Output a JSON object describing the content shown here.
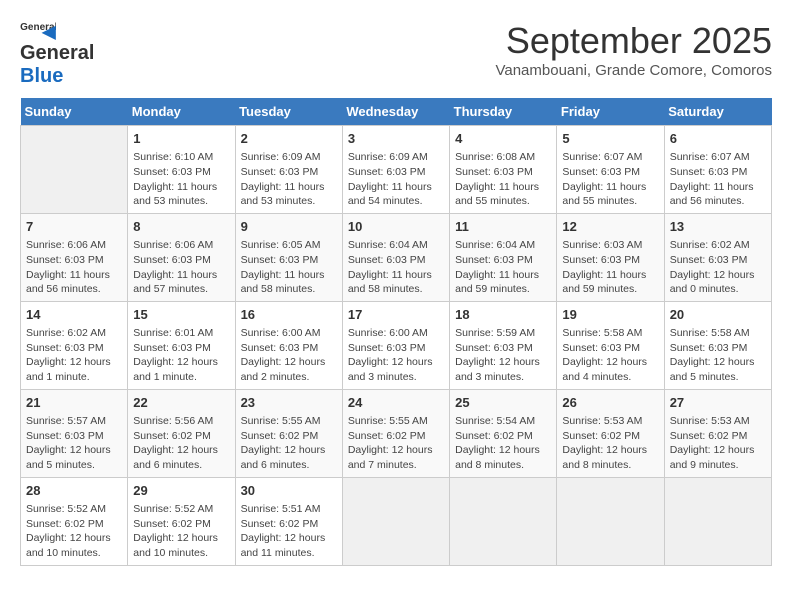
{
  "header": {
    "logo_top": "General",
    "logo_bottom": "Blue",
    "month": "September 2025",
    "location": "Vanambouani, Grande Comore, Comoros"
  },
  "days_of_week": [
    "Sunday",
    "Monday",
    "Tuesday",
    "Wednesday",
    "Thursday",
    "Friday",
    "Saturday"
  ],
  "weeks": [
    [
      {
        "day": "",
        "empty": true
      },
      {
        "day": "1",
        "sunrise": "6:10 AM",
        "sunset": "6:03 PM",
        "daylight": "11 hours and 53 minutes."
      },
      {
        "day": "2",
        "sunrise": "6:09 AM",
        "sunset": "6:03 PM",
        "daylight": "11 hours and 53 minutes."
      },
      {
        "day": "3",
        "sunrise": "6:09 AM",
        "sunset": "6:03 PM",
        "daylight": "11 hours and 54 minutes."
      },
      {
        "day": "4",
        "sunrise": "6:08 AM",
        "sunset": "6:03 PM",
        "daylight": "11 hours and 55 minutes."
      },
      {
        "day": "5",
        "sunrise": "6:07 AM",
        "sunset": "6:03 PM",
        "daylight": "11 hours and 55 minutes."
      },
      {
        "day": "6",
        "sunrise": "6:07 AM",
        "sunset": "6:03 PM",
        "daylight": "11 hours and 56 minutes."
      }
    ],
    [
      {
        "day": "7",
        "sunrise": "6:06 AM",
        "sunset": "6:03 PM",
        "daylight": "11 hours and 56 minutes."
      },
      {
        "day": "8",
        "sunrise": "6:06 AM",
        "sunset": "6:03 PM",
        "daylight": "11 hours and 57 minutes."
      },
      {
        "day": "9",
        "sunrise": "6:05 AM",
        "sunset": "6:03 PM",
        "daylight": "11 hours and 58 minutes."
      },
      {
        "day": "10",
        "sunrise": "6:04 AM",
        "sunset": "6:03 PM",
        "daylight": "11 hours and 58 minutes."
      },
      {
        "day": "11",
        "sunrise": "6:04 AM",
        "sunset": "6:03 PM",
        "daylight": "11 hours and 59 minutes."
      },
      {
        "day": "12",
        "sunrise": "6:03 AM",
        "sunset": "6:03 PM",
        "daylight": "11 hours and 59 minutes."
      },
      {
        "day": "13",
        "sunrise": "6:02 AM",
        "sunset": "6:03 PM",
        "daylight": "12 hours and 0 minutes."
      }
    ],
    [
      {
        "day": "14",
        "sunrise": "6:02 AM",
        "sunset": "6:03 PM",
        "daylight": "12 hours and 1 minute."
      },
      {
        "day": "15",
        "sunrise": "6:01 AM",
        "sunset": "6:03 PM",
        "daylight": "12 hours and 1 minute."
      },
      {
        "day": "16",
        "sunrise": "6:00 AM",
        "sunset": "6:03 PM",
        "daylight": "12 hours and 2 minutes."
      },
      {
        "day": "17",
        "sunrise": "6:00 AM",
        "sunset": "6:03 PM",
        "daylight": "12 hours and 3 minutes."
      },
      {
        "day": "18",
        "sunrise": "5:59 AM",
        "sunset": "6:03 PM",
        "daylight": "12 hours and 3 minutes."
      },
      {
        "day": "19",
        "sunrise": "5:58 AM",
        "sunset": "6:03 PM",
        "daylight": "12 hours and 4 minutes."
      },
      {
        "day": "20",
        "sunrise": "5:58 AM",
        "sunset": "6:03 PM",
        "daylight": "12 hours and 5 minutes."
      }
    ],
    [
      {
        "day": "21",
        "sunrise": "5:57 AM",
        "sunset": "6:03 PM",
        "daylight": "12 hours and 5 minutes."
      },
      {
        "day": "22",
        "sunrise": "5:56 AM",
        "sunset": "6:02 PM",
        "daylight": "12 hours and 6 minutes."
      },
      {
        "day": "23",
        "sunrise": "5:55 AM",
        "sunset": "6:02 PM",
        "daylight": "12 hours and 6 minutes."
      },
      {
        "day": "24",
        "sunrise": "5:55 AM",
        "sunset": "6:02 PM",
        "daylight": "12 hours and 7 minutes."
      },
      {
        "day": "25",
        "sunrise": "5:54 AM",
        "sunset": "6:02 PM",
        "daylight": "12 hours and 8 minutes."
      },
      {
        "day": "26",
        "sunrise": "5:53 AM",
        "sunset": "6:02 PM",
        "daylight": "12 hours and 8 minutes."
      },
      {
        "day": "27",
        "sunrise": "5:53 AM",
        "sunset": "6:02 PM",
        "daylight": "12 hours and 9 minutes."
      }
    ],
    [
      {
        "day": "28",
        "sunrise": "5:52 AM",
        "sunset": "6:02 PM",
        "daylight": "12 hours and 10 minutes."
      },
      {
        "day": "29",
        "sunrise": "5:52 AM",
        "sunset": "6:02 PM",
        "daylight": "12 hours and 10 minutes."
      },
      {
        "day": "30",
        "sunrise": "5:51 AM",
        "sunset": "6:02 PM",
        "daylight": "12 hours and 11 minutes."
      },
      {
        "day": "",
        "empty": true
      },
      {
        "day": "",
        "empty": true
      },
      {
        "day": "",
        "empty": true
      },
      {
        "day": "",
        "empty": true
      }
    ]
  ]
}
